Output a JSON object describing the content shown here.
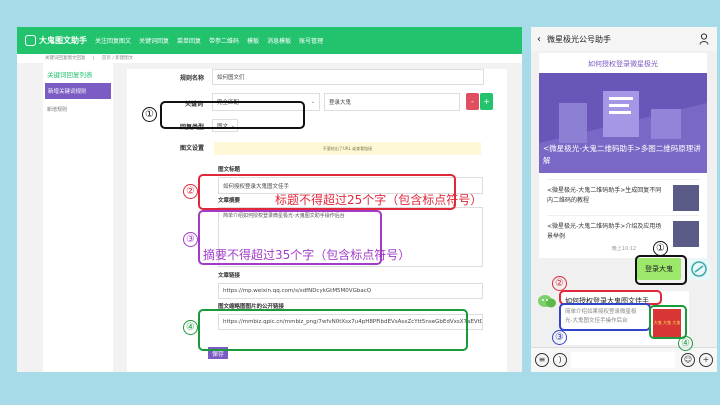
{
  "admin": {
    "logo_text": "大鬼图文助手",
    "nav": [
      "关注回复图文",
      "关键词回复",
      "菜单回复",
      "带参二维码",
      "模板",
      "消息模板",
      "账号管理"
    ],
    "breadcrumb": [
      "关键词回复图文回复",
      "首页",
      "新建图文"
    ],
    "sidebar": {
      "title": "关键词回复列表",
      "active": "新增关键词规则",
      "item": "新增规则"
    },
    "form": {
      "rule_label": "规则名称",
      "rule_value": "如何图文们",
      "keyword_label": "关键词",
      "keyword_match": "完全匹配",
      "keyword_value": "登录大鬼",
      "reply_type_label": "回复类型",
      "reply_type_value": "图文",
      "content_label": "图文设置",
      "tip": "不要给出了URL 或查看链接",
      "title_label": "图文标题",
      "title_value": "如何授权登录大鬼图文佳手",
      "summary_label": "文章摘要",
      "summary_value": "简单介绍如何授权登录微星极光-大鬼图文助手操作后台",
      "link_label": "文章链接",
      "link_value": "https://mp.weixin.qq.com/s/sdfNDcykGtM5M0VGbacQ",
      "cover_label": "图文缩略图图片的公开链接",
      "cover_value": "https://mmbiz.qpic.cn/mmbiz_png/7wfvN0tXsx7u4pH8PFibdEVsAsxZcYtt5nseGbEdVxsX7aEVtDrr45ia/icegqj9N9g",
      "save": "保存"
    }
  },
  "annotations": {
    "num1": "①",
    "num2": "②",
    "num3": "③",
    "num4": "④",
    "title_note": "标题不得超过25个字（包含标点符号）",
    "summary_note": "摘要不得超过35个字（包含标点符号）"
  },
  "phone": {
    "title": "微星极光公号助手",
    "card_subtitle": "如何授权登录微星极光",
    "cover_title": "<微星极光-大鬼二维码助手>多图二维码原理讲解",
    "list": [
      "<微星极光-大鬼二维码助手>生成回复不同内二维码的教程",
      "<微星极光-大鬼二维码助手>介绍及应用场景举例"
    ],
    "time": "晚上10:12",
    "sent_bubble": "登录大鬼",
    "link_title": "如何授权登录大鬼图文佳手",
    "link_desc": "简单介绍如果授权登录微星极光-大鬼图文佳手操作后台",
    "thumb_text": "大鬼 大鬼 大鬼"
  },
  "colors": {
    "green": "#23c36e",
    "purple": "#7a5cc4",
    "anno_red": "#e0283c",
    "anno_purple": "#a23cc8",
    "anno_green": "#1a9a3a",
    "anno_blue": "#3344cc"
  }
}
